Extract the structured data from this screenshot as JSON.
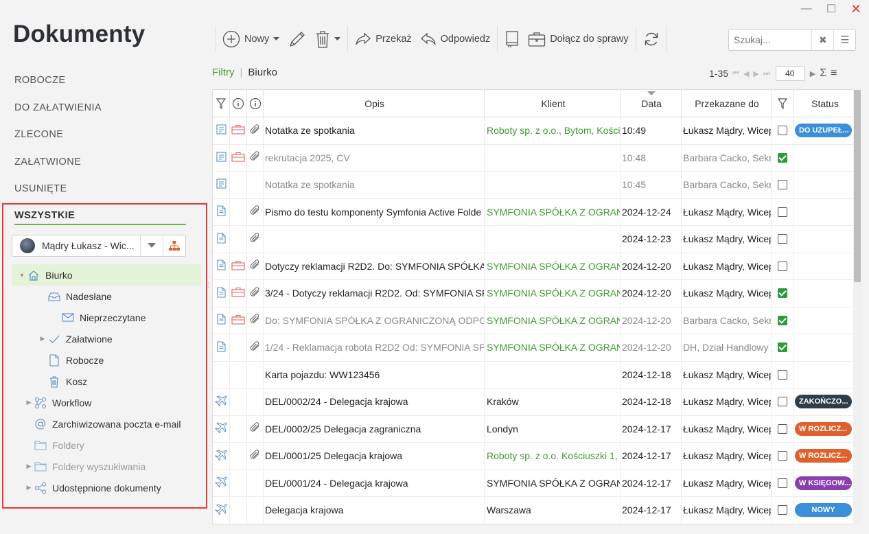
{
  "window": {
    "minimize": "—",
    "maximize": "☐",
    "close": "✕"
  },
  "app": {
    "title": "Dokumenty"
  },
  "categories": [
    "ROBOCZE",
    "DO ZAŁATWIENIA",
    "ZLECONE",
    "ZAŁATWIONE",
    "USUNIĘTE"
  ],
  "active_category": "WSZYSTKIE",
  "user_selector": {
    "name": "Mądry Łukasz - Wic..."
  },
  "tree": [
    {
      "label": "Biurko",
      "icon": "home-icon",
      "selected": true
    },
    {
      "label": "Nadesłane",
      "icon": "inbox-icon"
    },
    {
      "label": "Nieprzeczytane",
      "icon": "envelope-icon"
    },
    {
      "label": "Załatwione",
      "icon": "check-icon"
    },
    {
      "label": "Robocze",
      "icon": "document-icon"
    },
    {
      "label": "Kosz",
      "icon": "trash-icon"
    },
    {
      "label": "Workflow",
      "icon": "workflow-icon"
    },
    {
      "label": "Zarchiwizowana poczta e-mail",
      "icon": "at-icon"
    },
    {
      "label": "Foldery",
      "icon": "folder-icon"
    },
    {
      "label": "Foldery wyszukiwania",
      "icon": "folder-icon"
    },
    {
      "label": "Udostępnione dokumenty",
      "icon": "share-icon"
    }
  ],
  "toolbar": {
    "new_label": "Nowy",
    "forward_label": "Przekaż",
    "reply_label": "Odpowiedz",
    "attach_case_label": "Dołącz do sprawy"
  },
  "search": {
    "placeholder": "Szukaj..."
  },
  "breadcrumb": {
    "filters": "Filtry",
    "separator": "|",
    "current": "Biurko"
  },
  "pager": {
    "range": "1-35",
    "page_size": "40"
  },
  "columns": {
    "opis": "Opis",
    "klient": "Klient",
    "data": "Data",
    "przekazane": "Przekazane do",
    "status": "Status"
  },
  "colors": {
    "accent_green": "#6cb24a",
    "status_blue": "#3b8fd9",
    "status_dark": "#2f3d48",
    "status_orange": "#e0602b",
    "status_purple": "#8a3fb0",
    "checked": "#2e9a3e"
  },
  "rows": [
    {
      "type": "note",
      "case": true,
      "att": true,
      "opis": "Notatka ze spotkania",
      "klient": "Roboty sp. z o.o., Bytom, Kości",
      "klient_green": true,
      "data": "10:49",
      "przek": "Łukasz Mądry, Wicep",
      "checked": false,
      "status": "DO UZUPEŁ...",
      "status_color": "#3b8fd9",
      "grey": false
    },
    {
      "type": "note",
      "case": true,
      "att": true,
      "opis": "rekrutacja 2025, CV",
      "klient": "",
      "klient_green": false,
      "data": "10:48",
      "przek": "Barbara Cacko, Sekr",
      "checked": true,
      "status": "",
      "status_color": "",
      "grey": true
    },
    {
      "type": "note",
      "case": false,
      "att": false,
      "opis": "Notatka ze spotkania",
      "klient": "",
      "klient_green": false,
      "data": "10:45",
      "przek": "Barbara Cacko, Sekr",
      "checked": false,
      "status": "",
      "status_color": "",
      "grey": true
    },
    {
      "type": "doc",
      "case": false,
      "att": true,
      "opis": "Pismo do testu komponenty Symfonia Active Folde",
      "klient": "SYMFONIA SPÓŁKA Z OGRANI",
      "klient_green": true,
      "data": "2024-12-24",
      "przek": "Łukasz Mądry, Wicep",
      "checked": false,
      "status": "",
      "status_color": "",
      "grey": false
    },
    {
      "type": "doc",
      "case": false,
      "att": true,
      "opis": "",
      "klient": "",
      "klient_green": false,
      "data": "2024-12-23",
      "przek": "Łukasz Mądry, Wicep",
      "checked": false,
      "status": "",
      "status_color": "",
      "grey": false
    },
    {
      "type": "doc",
      "case": true,
      "att": true,
      "opis": "Dotyczy reklamacji R2D2. Do: SYMFONIA SPÓŁKA",
      "klient": "SYMFONIA SPÓŁKA Z OGRANI",
      "klient_green": true,
      "data": "2024-12-20",
      "przek": "Łukasz Mądry, Wicep",
      "checked": false,
      "status": "",
      "status_color": "",
      "grey": false
    },
    {
      "type": "doc",
      "case": true,
      "att": true,
      "opis": "3/24 - Dotyczy reklamacji R2D2. Od: SYMFONIA SF",
      "klient": "SYMFONIA SPÓŁKA Z OGRANI",
      "klient_green": true,
      "data": "2024-12-20",
      "przek": "Łukasz Mądry, Wicep",
      "checked": true,
      "status": "",
      "status_color": "",
      "grey": false
    },
    {
      "type": "doc",
      "case": true,
      "att": true,
      "opis": "Do: SYMFONIA SPÓŁKA Z OGRANICZONĄ ODPOW",
      "klient": "SYMFONIA SPÓŁKA Z OGRANI",
      "klient_green": true,
      "data": "2024-12-20",
      "przek": "Barbara Cacko, Sekr",
      "checked": true,
      "status": "",
      "status_color": "",
      "grey": true
    },
    {
      "type": "doc",
      "case": false,
      "att": true,
      "opis": "1/24 - Reklamacja robota R2D2 Od: SYMFONIA SP",
      "klient": "SYMFONIA SPÓŁKA Z OGRANI",
      "klient_green": true,
      "data": "2024-12-20",
      "przek": "DH, Dział Handlowy",
      "checked": true,
      "status": "",
      "status_color": "",
      "grey": true
    },
    {
      "type": "none",
      "case": false,
      "att": false,
      "opis": "Karta pojazdu: WW123456",
      "klient": "",
      "klient_green": false,
      "data": "2024-12-18",
      "przek": "Łukasz Mądry, Wicep",
      "checked": false,
      "status": "",
      "status_color": "",
      "grey": false
    },
    {
      "type": "plane",
      "case": false,
      "att": false,
      "opis": "DEL/0002/24 - Delegacja krajowa",
      "klient": "Kraków",
      "klient_green": false,
      "data": "2024-12-18",
      "przek": "Łukasz Mądry, Wicep",
      "checked": false,
      "status": "ZAKOŃCZO...",
      "status_color": "#2f3d48",
      "grey": false
    },
    {
      "type": "plane",
      "case": false,
      "att": true,
      "opis": "DEL/0002/25 Delegacja zagraniczna",
      "klient": "Londyn",
      "klient_green": false,
      "data": "2024-12-17",
      "przek": "Łukasz Mądry, Wicep",
      "checked": false,
      "status": "W ROZLICZ...",
      "status_color": "#e0602b",
      "grey": false
    },
    {
      "type": "plane",
      "case": false,
      "att": true,
      "opis": "DEL/0001/25 Delegacja krajowa",
      "klient": "Roboty sp. z o.o. Kościuszki 1,",
      "klient_green": true,
      "data": "2024-12-17",
      "przek": "Łukasz Mądry, Wicep",
      "checked": false,
      "status": "W ROZLICZ...",
      "status_color": "#e0602b",
      "grey": false
    },
    {
      "type": "plane",
      "case": false,
      "att": false,
      "opis": "DEL/0001/24 - Delegacja krajowa",
      "klient": "SYMFONIA SPÓŁKA Z OGRANI",
      "klient_green": false,
      "data": "2024-12-17",
      "przek": "Łukasz Mądry, Wicep",
      "checked": false,
      "status": "W KSIĘGOW...",
      "status_color": "#8a3fb0",
      "grey": false
    },
    {
      "type": "plane",
      "case": false,
      "att": false,
      "opis": "Delegacja krajowa",
      "klient": "Warszawa",
      "klient_green": false,
      "data": "2024-12-17",
      "przek": "Łukasz Mądry, Wicep",
      "checked": false,
      "status": "NOWY",
      "status_color": "#3b8fd9",
      "grey": false
    }
  ]
}
